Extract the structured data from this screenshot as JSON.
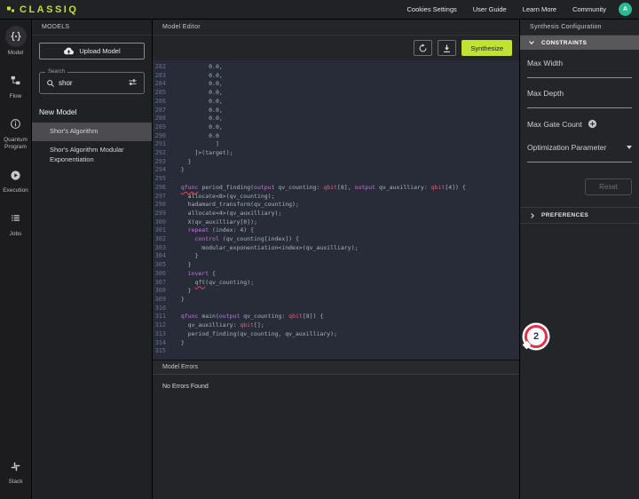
{
  "topbar": {
    "logo": "CLASSIQ",
    "links": [
      "Cookies Settings",
      "User Guide",
      "Learn More",
      "Community"
    ],
    "avatar": "A"
  },
  "nav": {
    "items": [
      {
        "label": "Model",
        "icon": "model-icon",
        "active": true
      },
      {
        "label": "Flow",
        "icon": "flow-icon",
        "active": false
      },
      {
        "label": "Quantum Program",
        "icon": "info-icon",
        "active": false
      },
      {
        "label": "Execution",
        "icon": "play-icon",
        "active": false
      },
      {
        "label": "Jobs",
        "icon": "list-icon",
        "active": false
      }
    ],
    "bottom": {
      "label": "Slack",
      "icon": "slack-icon"
    }
  },
  "models_panel": {
    "title": "MODELS",
    "upload_label": "Upload Model",
    "search": {
      "label": "Search",
      "value": "shor"
    },
    "new_model_label": "New Model",
    "items": [
      {
        "label": "Shor's Algorithm",
        "selected": true
      },
      {
        "label": "Shor's Algorithm Modular Exponentiation",
        "selected": false
      }
    ]
  },
  "editor": {
    "title": "Model Editor",
    "synthesize_label": "Synthesize",
    "lines": [
      {
        "n": 282,
        "s": "          0.0,"
      },
      {
        "n": 283,
        "s": "          0.0,"
      },
      {
        "n": 284,
        "s": "          0.0,"
      },
      {
        "n": 285,
        "s": "          0.0,"
      },
      {
        "n": 286,
        "s": "          0.0,"
      },
      {
        "n": 287,
        "s": "          0.0,"
      },
      {
        "n": 288,
        "s": "          0.0,"
      },
      {
        "n": 289,
        "s": "          0.0,"
      },
      {
        "n": 290,
        "s": "          0.0"
      },
      {
        "n": 291,
        "s": "            ]"
      },
      {
        "n": 292,
        "s": "      ]>(target);"
      },
      {
        "n": 293,
        "s": "    }"
      },
      {
        "n": 294,
        "s": "  }"
      },
      {
        "n": 295,
        "s": ""
      },
      {
        "n": 296,
        "s": [
          [
            "  ",
            "p"
          ],
          [
            "qfunc",
            "k e"
          ],
          [
            " period_finding(",
            "p"
          ],
          [
            "output",
            "k"
          ],
          [
            " qv_counting: ",
            "p"
          ],
          [
            "qbit",
            "t"
          ],
          [
            "[8], ",
            "p"
          ],
          [
            "output",
            "k"
          ],
          [
            " qv_auxilliary: ",
            "p"
          ],
          [
            "qbit",
            "t"
          ],
          [
            "[4]) {",
            "p"
          ]
        ]
      },
      {
        "n": 297,
        "s": "    allocate<8>(qv_counting);"
      },
      {
        "n": 298,
        "s": "    hadamard_transform(qv_counting);"
      },
      {
        "n": 299,
        "s": "    allocate<4>(qv_auxilliary);"
      },
      {
        "n": 300,
        "s": "    X(qv_auxilliary[0]);"
      },
      {
        "n": 301,
        "s": [
          [
            "    ",
            "p"
          ],
          [
            "repeat",
            "k"
          ],
          [
            " (index: 4) {",
            "p"
          ]
        ]
      },
      {
        "n": 302,
        "s": [
          [
            "      ",
            "p"
          ],
          [
            "control",
            "k"
          ],
          [
            " (qv_counting[index]) {",
            "p"
          ]
        ]
      },
      {
        "n": 303,
        "s": "        modular_exponentiation<index>(qv_auxilliary);"
      },
      {
        "n": 304,
        "s": "      }"
      },
      {
        "n": 305,
        "s": "    }"
      },
      {
        "n": 306,
        "s": [
          [
            "    ",
            "p"
          ],
          [
            "invert",
            "k"
          ],
          [
            " {",
            "p"
          ]
        ]
      },
      {
        "n": 307,
        "s": [
          [
            "      ",
            "p"
          ],
          [
            "qft",
            "p e"
          ],
          [
            "(qv_counting);",
            "p"
          ]
        ]
      },
      {
        "n": 308,
        "s": "    }"
      },
      {
        "n": 309,
        "s": "  }"
      },
      {
        "n": 310,
        "s": ""
      },
      {
        "n": 311,
        "s": [
          [
            "  ",
            "p"
          ],
          [
            "qfunc",
            "k"
          ],
          [
            " main(",
            "p"
          ],
          [
            "output",
            "k"
          ],
          [
            " qv_counting: ",
            "p"
          ],
          [
            "qbit",
            "t"
          ],
          [
            "[8]) {",
            "p"
          ]
        ]
      },
      {
        "n": 312,
        "s": [
          [
            "    qv_auxilliary: ",
            "p"
          ],
          [
            "qbit",
            "t"
          ],
          [
            "[];",
            "p"
          ]
        ]
      },
      {
        "n": 313,
        "s": "    period_finding(qv_counting, qv_auxilliary);"
      },
      {
        "n": 314,
        "s": "  }"
      },
      {
        "n": 315,
        "s": ""
      }
    ]
  },
  "errors_panel": {
    "title": "Model Errors",
    "message": "No Errors Found"
  },
  "config_panel": {
    "title": "Synthesis Configuration",
    "constraints_label": "CONSTRAINTS",
    "fields": [
      {
        "label": "Max Width",
        "type": "text"
      },
      {
        "label": "Max Depth",
        "type": "text"
      },
      {
        "label": "Max Gate Count",
        "type": "add"
      },
      {
        "label": "Optimization Parameter",
        "type": "select"
      }
    ],
    "reset_label": "Reset",
    "preferences_label": "PREFERENCES"
  },
  "annotation": {
    "label": "2"
  },
  "colors": {
    "accent": "#bfe330",
    "avatar": "#2cb890",
    "keyword": "#c678dd",
    "qbit_type": "#e0646e",
    "error_underline": "#e04b4b",
    "annotation_ring": "#e0314b",
    "selected_item": "#4c4c50",
    "code_background": "#272c38"
  }
}
